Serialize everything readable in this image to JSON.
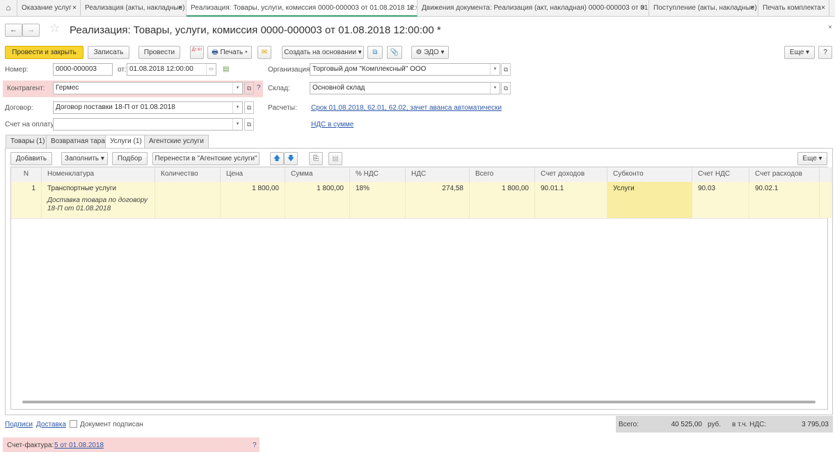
{
  "tabs": [
    {
      "label": "Оказание услуг"
    },
    {
      "label": "Реализация (акты, накладные)"
    },
    {
      "label": "Реализация: Товары, услуги, комиссия 0000-000003 от 01.08.2018 12:0..."
    },
    {
      "label": "Движения документа: Реализация (акт, накладная) 0000-000003 от 01...."
    },
    {
      "label": "Поступление (акты, накладные)"
    },
    {
      "label": "Печать комплекта"
    }
  ],
  "title": "Реализация: Товары, услуги, комиссия 0000-000003 от 01.08.2018 12:00:00 *",
  "toolbar": {
    "post_close": "Провести и закрыть",
    "save": "Записать",
    "post": "Провести",
    "dtkt": "Дт Кт",
    "print": "Печать",
    "create_based": "Создать на основании",
    "edo": "ЭДО",
    "more": "Еще",
    "help": "?"
  },
  "form": {
    "number_label": "Номер:",
    "number": "0000-000003",
    "date_label": "от:",
    "date": "01.08.2018 12:00:00",
    "counterparty_label": "Контрагент:",
    "counterparty": "Гермес",
    "contract_label": "Договор:",
    "contract": "Договор поставки 18-П от 01.08.2018",
    "invoice_label": "Счет на оплату:",
    "invoice": "",
    "org_label": "Организация:",
    "org": "Торговый дом \"Комплексный\" ООО",
    "warehouse_label": "Склад:",
    "warehouse": "Основной склад",
    "settlements_label": "Расчеты:",
    "settlements": "Срок 01.08.2018, 62.01, 62.02, зачет аванса автоматически",
    "vat_link": "НДС в сумме",
    "question": "?"
  },
  "form_tabs": [
    {
      "label": "Товары (1)"
    },
    {
      "label": "Возвратная тара"
    },
    {
      "label": "Услуги (1)"
    },
    {
      "label": "Агентские услуги"
    }
  ],
  "table_toolbar": {
    "add": "Добавить",
    "fill": "Заполнить",
    "pick": "Подбор",
    "move": "Перенести в \"Агентские услуги\"",
    "more": "Еще"
  },
  "columns": [
    "N",
    "Номенклатура",
    "Количество",
    "Цена",
    "Сумма",
    "% НДС",
    "НДС",
    "Всего",
    "Счет доходов",
    "Субконто",
    "Счет НДС",
    "Счет расходов"
  ],
  "rows": [
    {
      "n": "1",
      "item": "Транспортные услуги",
      "content": "Доставка товара по договору 18-П от 01.08.2018",
      "qty": "",
      "price": "1 800,00",
      "sum": "1 800,00",
      "vat_rate": "18%",
      "vat": "274,58",
      "total": "1 800,00",
      "income_acc": "90.01.1",
      "subconto": "Услуги",
      "vat_acc": "90.03",
      "expense_acc": "90.02.1"
    }
  ],
  "footer": {
    "signatures": "Подписи",
    "delivery": "Доставка",
    "signed_label": "Документ подписан",
    "total_label": "Всего:",
    "total": "40 525,00",
    "currency": "руб.",
    "vat_label": "в т.ч. НДС:",
    "vat": "3 795,03",
    "sf_label": "Счет-фактура:",
    "sf": "5 от 01.08.2018",
    "sf_q": "?"
  }
}
